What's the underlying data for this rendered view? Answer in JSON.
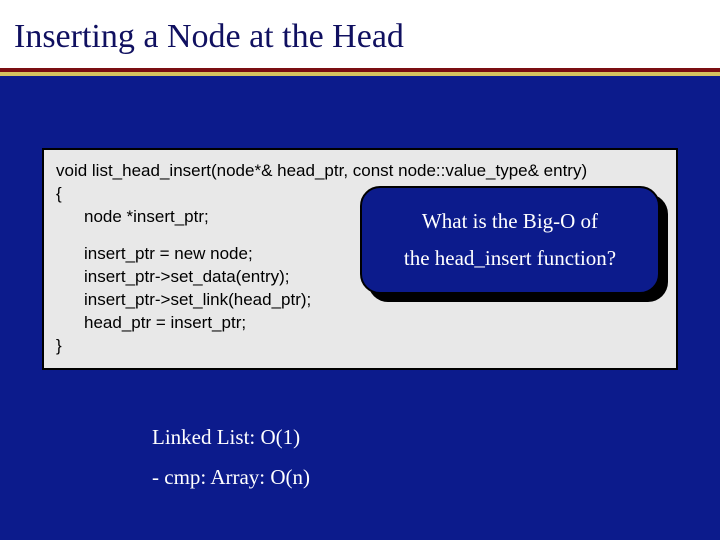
{
  "title": "Inserting a Node at the Head",
  "code": {
    "l1": "void list_head_insert(node*& head_ptr, const node::value_type& entry)",
    "l2": "{",
    "l3": "node *insert_ptr;",
    "l4": "insert_ptr = new node;",
    "l5": "insert_ptr->set_data(entry);",
    "l6": "insert_ptr->set_link(head_ptr);",
    "l7": "head_ptr = insert_ptr;",
    "l8": "}"
  },
  "callout": {
    "line1": "What is the Big-O of",
    "line2": "the head_insert function?"
  },
  "footer": {
    "line1": "Linked List:  O(1)",
    "line2": "- cmp:  Array: O(n)"
  }
}
